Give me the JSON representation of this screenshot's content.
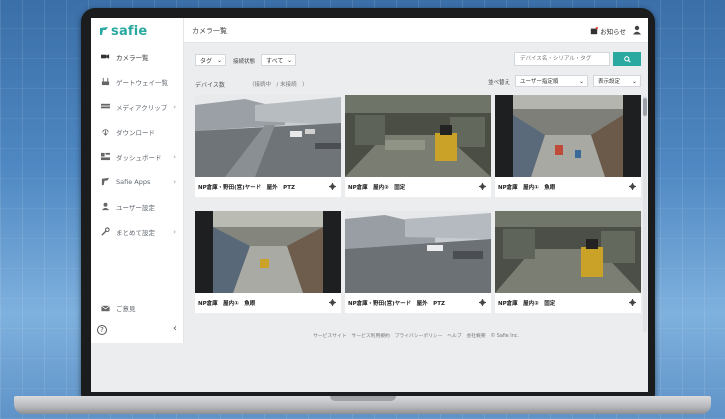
{
  "app": {
    "logo_text": "safie",
    "accent_color": "#2aa9a0"
  },
  "header": {
    "title": "カメラ一覧",
    "notice_label": "お知らせ"
  },
  "sidebar": {
    "items": [
      {
        "label": "カメラ一覧",
        "icon": "camera-icon",
        "chevron": ""
      },
      {
        "label": "ゲートウェイ一覧",
        "icon": "gateway-icon",
        "chevron": ""
      },
      {
        "label": "メディアクリップ",
        "icon": "media-clip-icon",
        "chevron": "›"
      },
      {
        "label": "ダウンロード",
        "icon": "download-icon",
        "chevron": ""
      },
      {
        "label": "ダッシュボード",
        "icon": "dashboard-icon",
        "chevron": "›"
      },
      {
        "label": "Safie Apps",
        "icon": "apps-icon",
        "chevron": "›"
      },
      {
        "label": "ユーザー設定",
        "icon": "user-settings-icon",
        "chevron": ""
      },
      {
        "label": "まとめて設定",
        "icon": "bulk-settings-icon",
        "chevron": "›"
      }
    ],
    "feedback_label": "ご意見",
    "help_label": "?",
    "collapse_label": "‹"
  },
  "toolbar": {
    "tag_select": "タグ",
    "connection_label": "接続状態",
    "connection_select": "すべて",
    "search_placeholder": "デバイス名・シリアル・タグ",
    "search_button": "Q",
    "device_count_label": "デバイス数",
    "device_status": "（接続中　/ 未接続　）",
    "sort_label": "並べ替え",
    "sort_select": "ユーザー指定順",
    "view_select": "表示設定",
    "dropdown_glyph": "⌄"
  },
  "cameras": [
    {
      "name": "NP倉庫・野田(営)ヤード　屋外　PTZ"
    },
    {
      "name": "NP倉庫　屋内②　固定"
    },
    {
      "name": "NP倉庫　屋内①　魚眼"
    },
    {
      "name": "NP倉庫　屋内①　魚眼"
    },
    {
      "name": "NP倉庫・野田(営)ヤード　屋外　PTZ"
    },
    {
      "name": "NP倉庫　屋内②　固定"
    }
  ],
  "footer": {
    "text": "サービスサイト　サービス利用規約　プライバシーポリシー　ヘルプ　会社概要　© Safie Inc."
  }
}
